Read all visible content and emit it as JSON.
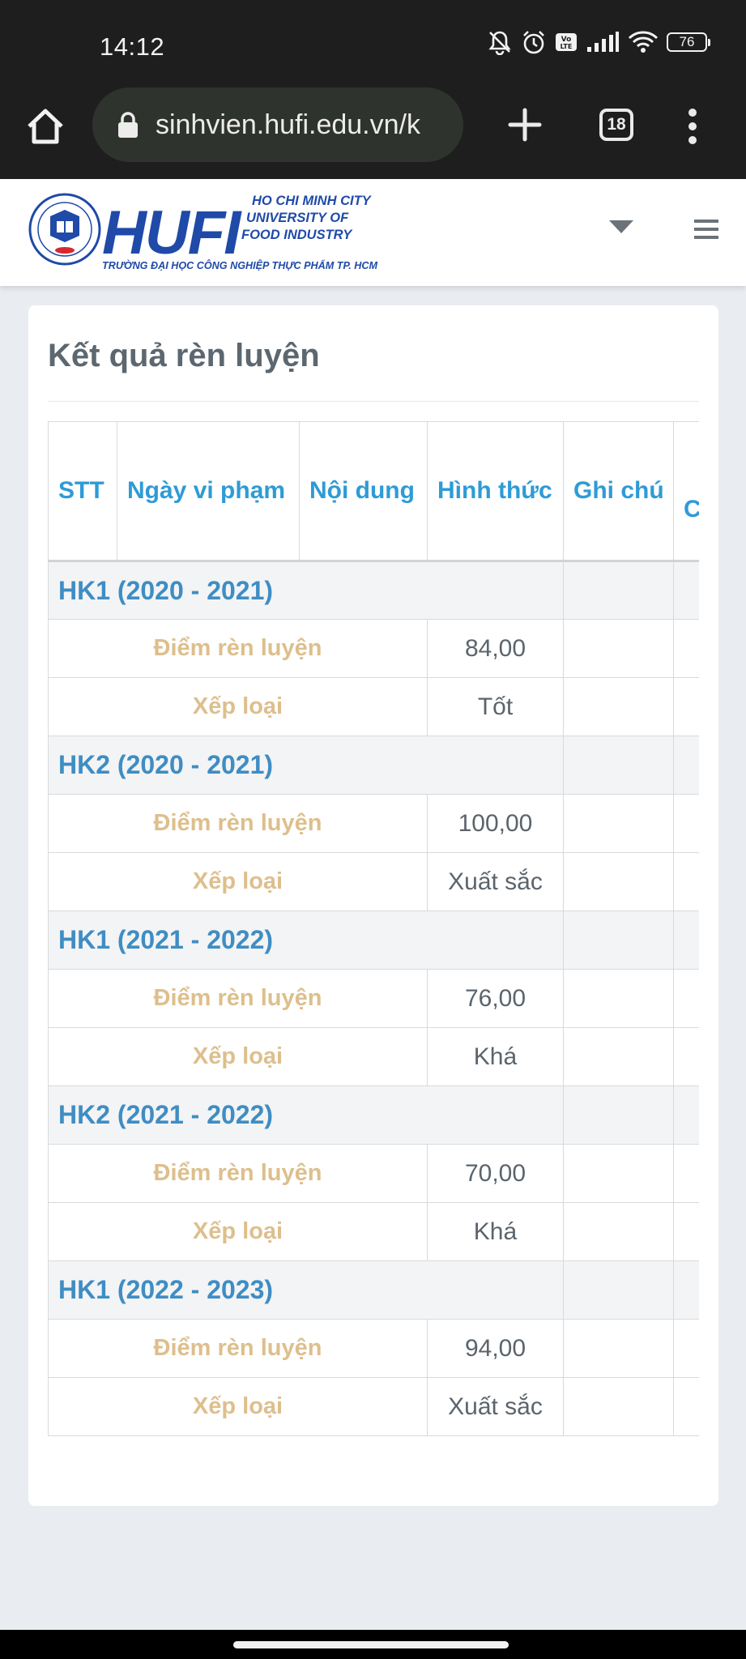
{
  "status_bar": {
    "time": "14:12",
    "battery": "76",
    "icons": [
      "mute-icon",
      "alarm-icon",
      "volte-icon",
      "signal-icon",
      "wifi-icon",
      "battery-icon"
    ]
  },
  "browser": {
    "url": "sinhvien.hufi.edu.vn/k",
    "tab_count": "18",
    "icons": [
      "home-icon",
      "lock-icon",
      "plus-icon",
      "tabs-icon",
      "more-vert-icon"
    ]
  },
  "site_header": {
    "logo": {
      "wordmark": "HUFI",
      "english_lines": [
        "HO CHI MINH CITY",
        "UNIVERSITY OF",
        "FOOD INDUSTRY"
      ],
      "vietnamese_name": "TRƯỜNG ĐẠI HỌC CÔNG NGHIỆP THỰC PHẨM TP. HCM"
    },
    "icons": [
      "caret-down-icon",
      "hamburger-menu-icon"
    ]
  },
  "page": {
    "title": "Kết quả rèn luyện",
    "table": {
      "headers": [
        "STT",
        "Ngày vi phạm",
        "Nội dung",
        "Hình thức",
        "Ghi chú",
        "C"
      ],
      "groups": [
        {
          "label": "HK1 (2020 - 2021)",
          "rows": [
            {
              "label": "Điểm rèn luyện",
              "value": "84,00"
            },
            {
              "label": "Xếp loại",
              "value": "Tốt"
            }
          ]
        },
        {
          "label": "HK2 (2020 - 2021)",
          "rows": [
            {
              "label": "Điểm rèn luyện",
              "value": "100,00"
            },
            {
              "label": "Xếp loại",
              "value": "Xuất sắc"
            }
          ]
        },
        {
          "label": "HK1 (2021 - 2022)",
          "rows": [
            {
              "label": "Điểm rèn luyện",
              "value": "76,00"
            },
            {
              "label": "Xếp loại",
              "value": "Khá"
            }
          ]
        },
        {
          "label": "HK2 (2021 - 2022)",
          "rows": [
            {
              "label": "Điểm rèn luyện",
              "value": "70,00"
            },
            {
              "label": "Xếp loại",
              "value": "Khá"
            }
          ]
        },
        {
          "label": "HK1 (2022 - 2023)",
          "rows": [
            {
              "label": "Điểm rèn luyện",
              "value": "94,00"
            },
            {
              "label": "Xếp loại",
              "value": "Xuất sắc"
            }
          ]
        }
      ]
    }
  },
  "colors": {
    "header_text": "#2e9bd6",
    "group_label": "#3f8dc3",
    "metric_label": "#ddbf8d",
    "logo_blue": "#1f4aa8"
  }
}
